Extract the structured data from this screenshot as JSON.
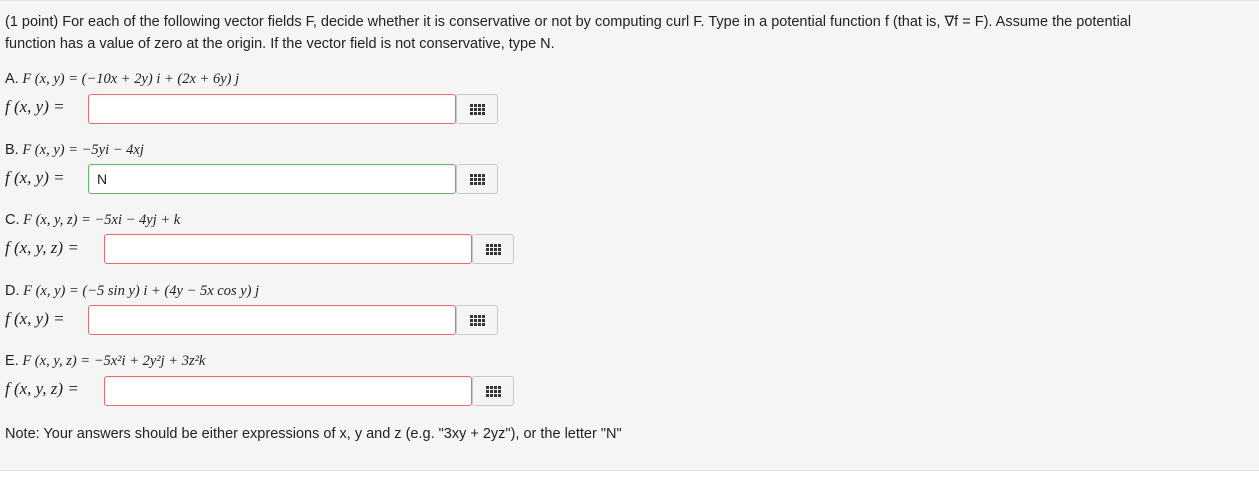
{
  "problem": {
    "intro_line1": "(1 point) For each of the following vector fields F, decide whether it is conservative or not by computing curl F. Type in a potential function f (that is, ∇f = F). Assume the potential",
    "intro_line2": "function has a value of zero at the origin. If the vector field is not conservative, type N."
  },
  "parts": [
    {
      "label": "A.",
      "field": "F (x, y) = (−10x + 2y) i + (2x + 6y) j",
      "answer_label": "f (x, y) =",
      "value": "",
      "status": "incorrect"
    },
    {
      "label": "B.",
      "field": "F (x, y) = −5yi − 4xj",
      "answer_label": "f (x, y) =",
      "value": "N",
      "status": "correct"
    },
    {
      "label": "C.",
      "field": "F (x, y, z) = −5xi − 4yj + k",
      "answer_label": "f (x, y, z) =",
      "value": "",
      "status": "incorrect"
    },
    {
      "label": "D.",
      "field": "F (x, y) = (−5 sin y) i + (4y − 5x cos y) j",
      "answer_label": "f (x, y) =",
      "value": "",
      "status": "incorrect"
    },
    {
      "label": "E.",
      "field": "F (x, y, z) = −5x²i + 2y²j + 3z²k",
      "answer_label": "f (x, y, z) =",
      "value": "",
      "status": "incorrect"
    }
  ],
  "note": "Note: Your answers should be either expressions of x, y and z (e.g. \"3xy + 2yz\"), or the letter \"N\"",
  "icons": {
    "equation_button": "grid-icon"
  },
  "colors": {
    "incorrect_border": "#e07070",
    "correct_border": "#66b866",
    "background": "#f5f5f5"
  }
}
